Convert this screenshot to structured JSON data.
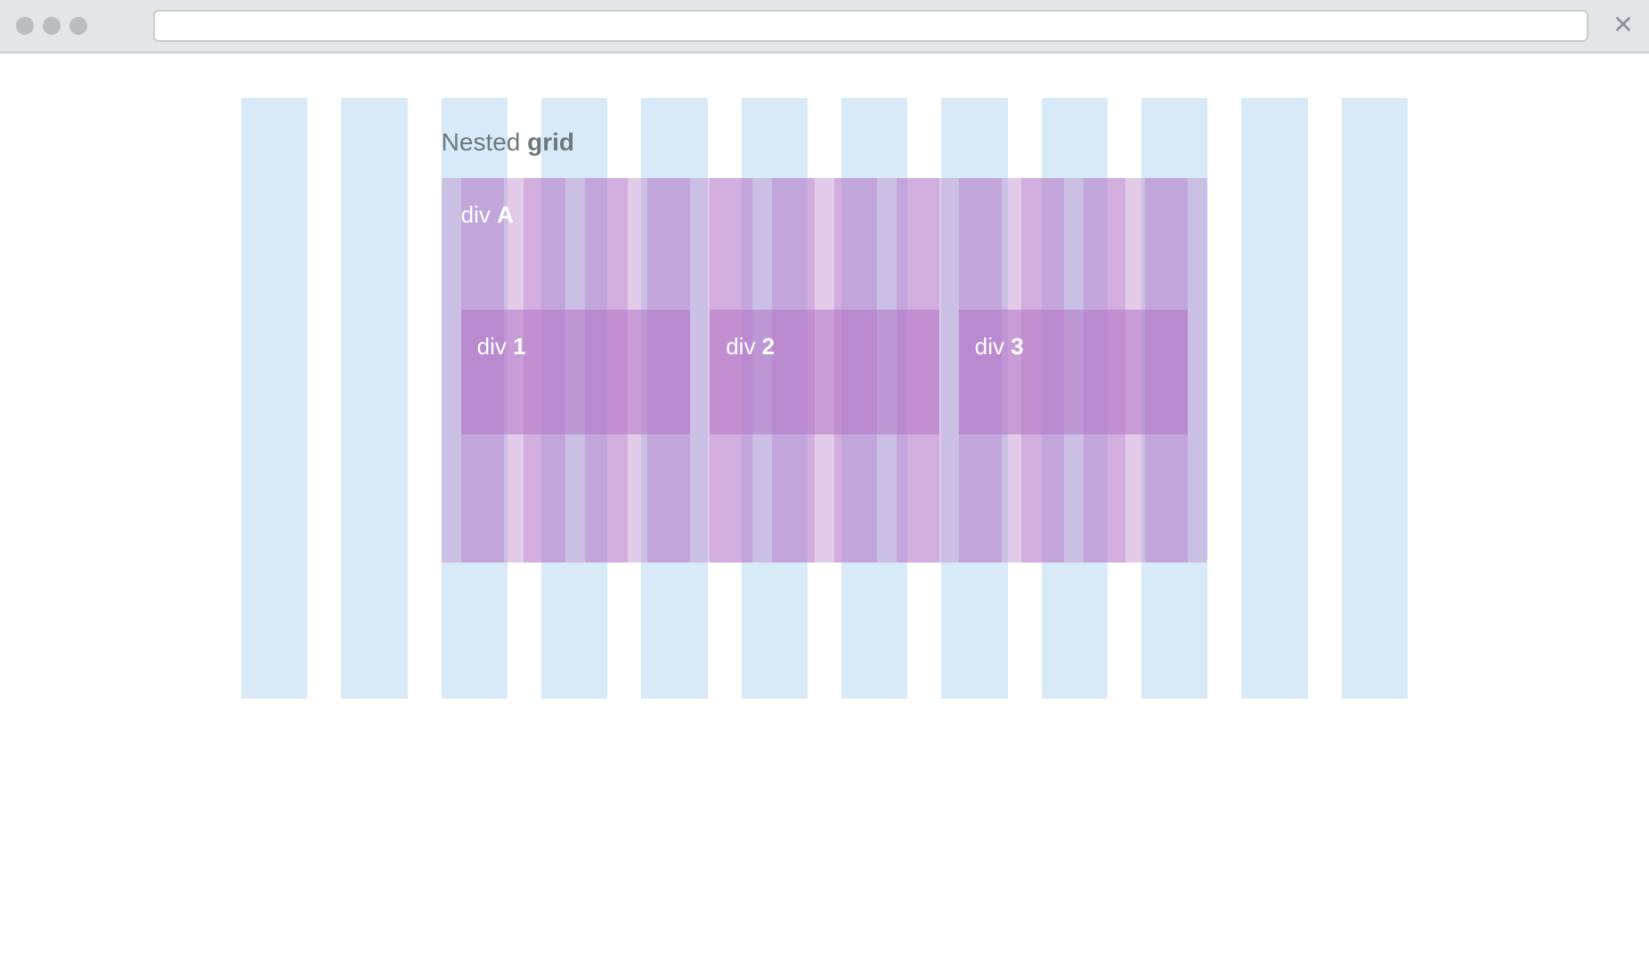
{
  "browser": {
    "url": ""
  },
  "title": {
    "prefix": "Nested ",
    "bold": "grid"
  },
  "outer_box": {
    "label_prefix": "div ",
    "label_bold": "A"
  },
  "inner_blocks": [
    {
      "prefix": "div ",
      "bold": "1"
    },
    {
      "prefix": "div ",
      "bold": "2"
    },
    {
      "prefix": "div ",
      "bold": "3"
    }
  ],
  "grid": {
    "outer_columns": 12,
    "inner_columns": 12
  },
  "colors": {
    "outer_column": "#d8e9f7",
    "purple_light": "rgba(188,140,205,0.45)",
    "purple_stripe": "rgba(175,110,198,0.30)",
    "purple_block": "rgba(175,110,198,0.50)",
    "chrome_bg": "#e3e6e8",
    "title_text": "#6c787e"
  }
}
